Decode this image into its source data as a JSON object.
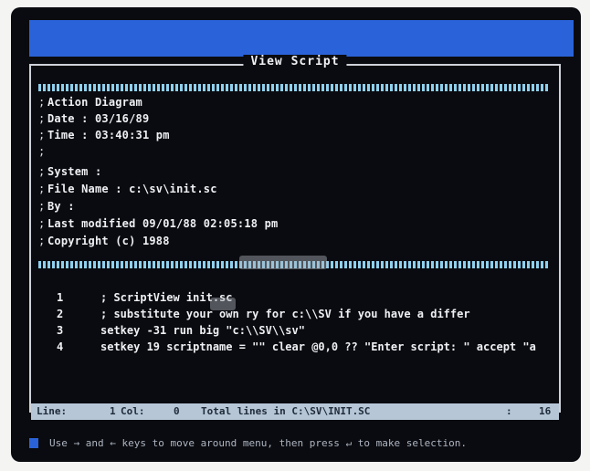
{
  "panel": {
    "title": "View Script"
  },
  "header_lines": [
    "Action Diagram",
    "Date : 03/16/89",
    "Time : 03:40:31 pm",
    "",
    "System :",
    "File Name : c:\\sv\\init.sc",
    "By :",
    "Last modified 09/01/88  02:05:18 pm",
    "Copyright (c) 1988"
  ],
  "code_lines": [
    {
      "num": "1",
      "text": "; ScriptView init.sc"
    },
    {
      "num": "2",
      "text": "; substitute your own              ry for c:\\\\SV if you have a differ"
    },
    {
      "num": "3",
      "text": "setkey -31 run big \"c:\\\\SV\\\\sv\""
    },
    {
      "num": "4",
      "text": "setkey 19 scriptname = \"\" clear @0,0 ?? \"Enter script: \" accept \"a"
    }
  ],
  "status": {
    "line_label": "Line:",
    "line_value": "1",
    "col_label": "Col:",
    "col_value": "0",
    "total_label": "Total lines in C:\\SV\\INIT.SC",
    "total_value": "16"
  },
  "help": {
    "text": "Use → and ← keys to move around menu, then press ↵ to make selection."
  },
  "colors": {
    "screen_bg": "#0a0b10",
    "menu_bar": "#2a63d9",
    "status_bar": "#b6c6d6",
    "rule": "#8fd0ee"
  }
}
